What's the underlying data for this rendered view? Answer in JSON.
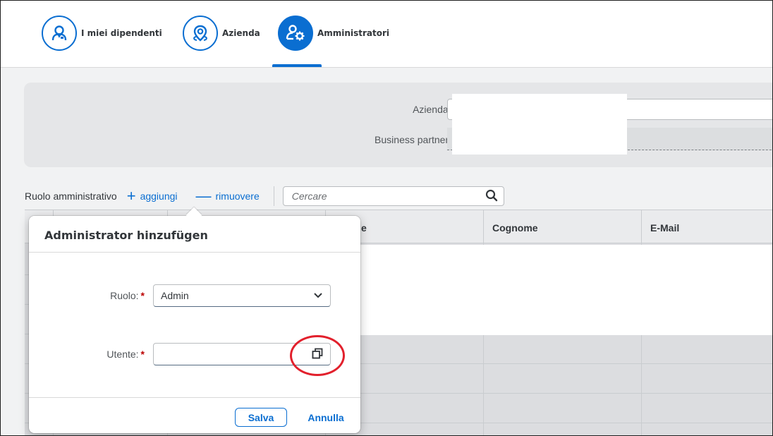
{
  "tabs": [
    {
      "label": "I miei dipendenti",
      "icon": "employee-icon",
      "active": false
    },
    {
      "label": "Azienda",
      "icon": "location-pin-icon",
      "active": false
    },
    {
      "label": "Amministratori",
      "icon": "admin-settings-icon",
      "active": true
    }
  ],
  "filter": {
    "company_label": "Azienda:",
    "business_partner_label": "Business partner:",
    "required_mark": "*"
  },
  "toolbar": {
    "title": "Ruolo amministrativo",
    "add_label": "aggiungi",
    "remove_label": "rimuovere",
    "search_placeholder": "Cercare"
  },
  "table": {
    "columns": [
      "",
      "",
      "",
      "e",
      "Cognome",
      "E-Mail"
    ]
  },
  "dialog": {
    "title": "Administrator hinzufügen",
    "role_label": "Ruolo:",
    "role_value": "Admin",
    "user_label": "Utente:",
    "required_mark": "*",
    "save_label": "Salva",
    "cancel_label": "Annulla"
  },
  "colors": {
    "accent": "#0a6ed1",
    "required": "#bb0000",
    "highlight": "#e2202c"
  }
}
